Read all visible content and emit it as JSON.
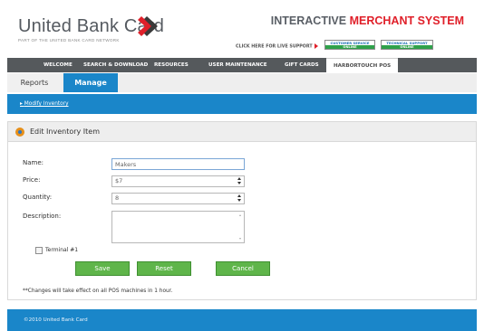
{
  "brand": {
    "name": "United Bank Card",
    "tagline": "PART OF THE UNITED BANK CARD NETWORK",
    "system_title_part1": "INTERACTIVE",
    "system_title_part2": "MERCHANT SYSTEM",
    "accent_color": "#e0202a"
  },
  "support": {
    "prompt": "CLICK HERE FOR LIVE SUPPORT",
    "customer_service_top": "CUSTOMER SERVICE",
    "customer_service_bottom": "ONLINE",
    "technical_support_top": "TECHNICAL SUPPORT",
    "technical_support_bottom": "ONLINE"
  },
  "nav": {
    "items": [
      {
        "label": "WELCOME"
      },
      {
        "label": "SEARCH & DOWNLOAD"
      },
      {
        "label": "RESOURCES"
      },
      {
        "label": "USER MAINTENANCE"
      },
      {
        "label": "GIFT CARDS"
      },
      {
        "label": "HARBORTOUCH POS"
      }
    ],
    "active_index": 5
  },
  "subtabs": {
    "items": [
      {
        "label": "Reports"
      },
      {
        "label": "Manage"
      }
    ],
    "active_index": 1,
    "accent_color": "#1a86c9"
  },
  "breadcrumb": {
    "link": "Modify Inventory"
  },
  "panel": {
    "title": "Edit Inventory Item",
    "labels": {
      "name": "Name:",
      "price": "Price:",
      "quantity": "Quantity:",
      "description": "Description:",
      "terminal": "Terminal #1"
    },
    "fields": {
      "name_value": "Makers",
      "price_value": "$7",
      "quantity_value": "8",
      "description_value": ""
    },
    "terminal_checked": false,
    "buttons": {
      "save": "Save",
      "reset": "Reset",
      "cancel": "Cancel"
    },
    "note": "**Changes will take effect on all POS machines in 1 hour."
  },
  "footer": {
    "text": "©2010 United Bank Card"
  }
}
